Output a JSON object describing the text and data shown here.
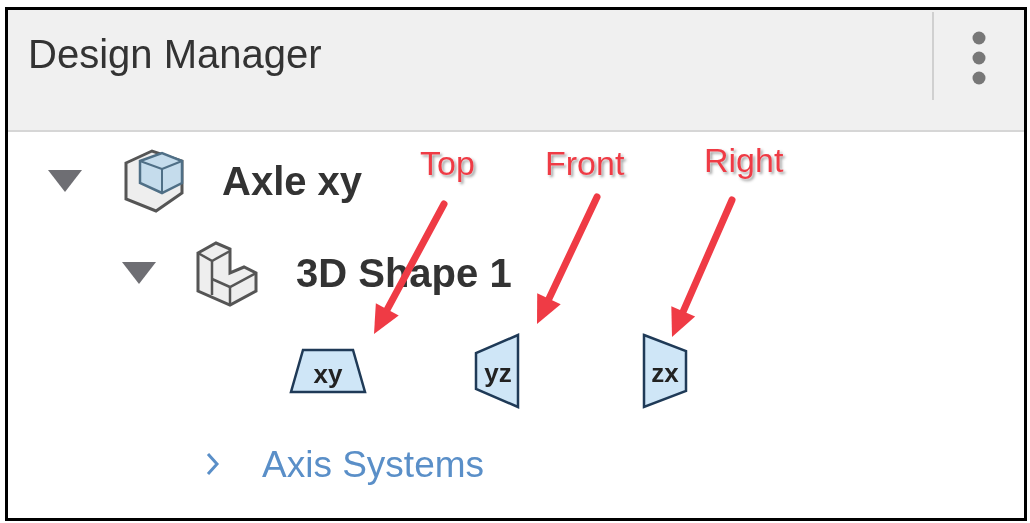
{
  "panel": {
    "title": "Design Manager"
  },
  "tree": [
    {
      "label": "Axle xy",
      "kind": "assembly",
      "expanded": true,
      "children": [
        {
          "label": "3D Shape 1",
          "kind": "part",
          "expanded": true,
          "planes": [
            {
              "label": "xy",
              "kind": "top"
            },
            {
              "label": "yz",
              "kind": "front"
            },
            {
              "label": "zx",
              "kind": "right"
            }
          ],
          "children": [
            {
              "label": "Axis Systems",
              "kind": "folder",
              "expanded": false
            }
          ]
        }
      ]
    }
  ],
  "annotations": [
    {
      "text": "Top"
    },
    {
      "text": "Front"
    },
    {
      "text": "Right"
    }
  ]
}
